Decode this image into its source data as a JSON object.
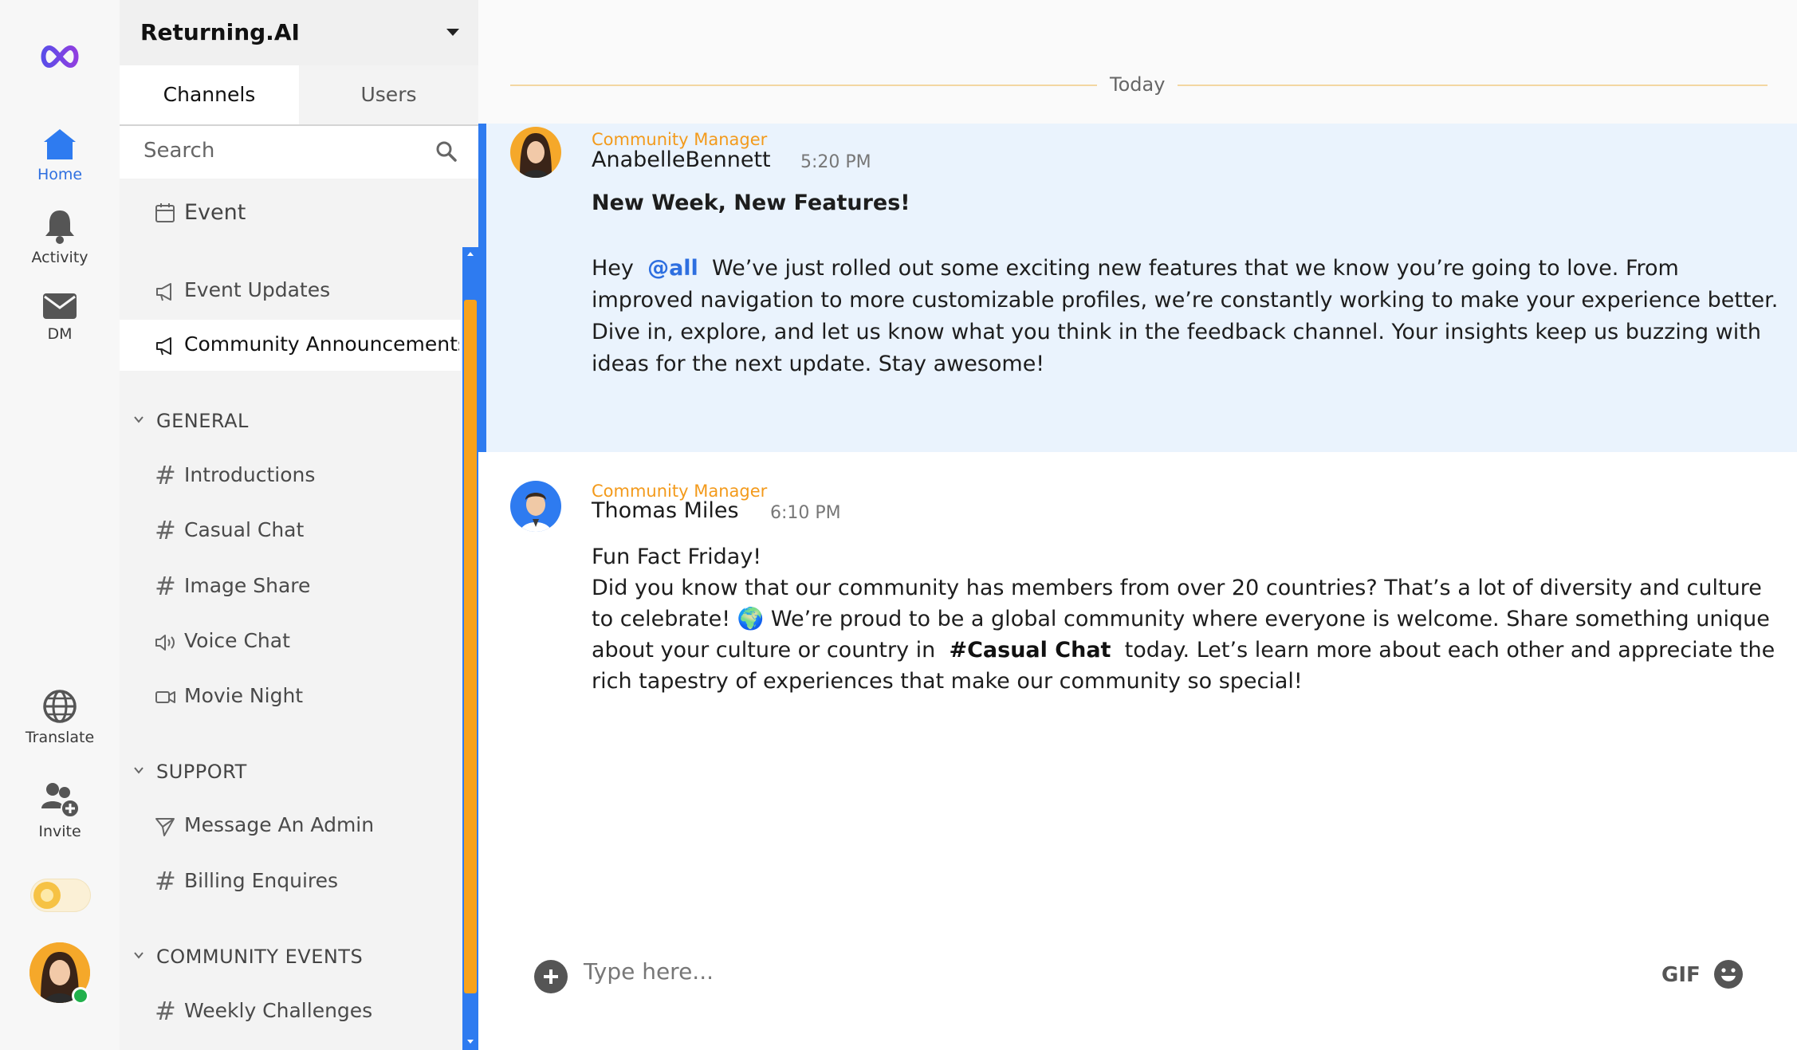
{
  "rail": {
    "logo": "infinity-logo",
    "items": [
      {
        "label": "Home",
        "icon": "home-icon"
      },
      {
        "label": "Activity",
        "icon": "bell-icon"
      },
      {
        "label": "DM",
        "icon": "mail-icon"
      },
      {
        "label": "Translate",
        "icon": "globe-icon"
      },
      {
        "label": "Invite",
        "icon": "add-users-icon"
      }
    ],
    "accent": "#2e6fe0"
  },
  "workspace": {
    "name": "Returning.AI"
  },
  "tabs": [
    {
      "label": "Channels"
    },
    {
      "label": "Users"
    }
  ],
  "search": {
    "placeholder": "Search"
  },
  "channels": {
    "event_header": "Event",
    "events": [
      {
        "name": "Event Updates",
        "icon": "megaphone-icon"
      },
      {
        "name": "Community Announcements",
        "icon": "megaphone-icon"
      }
    ],
    "groups": [
      {
        "name": "GENERAL",
        "items": [
          {
            "name": "Introductions",
            "icon": "hash-icon"
          },
          {
            "name": "Casual Chat",
            "icon": "hash-icon"
          },
          {
            "name": "Image Share",
            "icon": "hash-icon"
          },
          {
            "name": "Voice Chat",
            "icon": "speaker-icon"
          },
          {
            "name": "Movie Night",
            "icon": "video-icon"
          }
        ]
      },
      {
        "name": "SUPPORT",
        "items": [
          {
            "name": "Message An Admin",
            "icon": "send-icon"
          },
          {
            "name": "Billing Enquires",
            "icon": "hash-icon"
          }
        ]
      },
      {
        "name": "COMMUNITY EVENTS",
        "items": [
          {
            "name": "Weekly Challenges",
            "icon": "hash-icon"
          }
        ]
      }
    ]
  },
  "chat": {
    "date_divider": "Today",
    "messages": [
      {
        "role": "Community Manager",
        "author": "AnabelleBennett",
        "time": "5:20 PM",
        "title": "New Week, New Features!",
        "body_prefix": "Hey",
        "mention": "@all",
        "body": "We’ve just rolled out some exciting new features that we know you’re going to love. From improved navigation to more customizable profiles, we’re constantly working to make your experience better. Dive in, explore, and let us know what you think in the feedback channel. Your insights keep us buzzing with ideas for the next update. Stay awesome!"
      },
      {
        "role": "Community Manager",
        "author": "Thomas Miles",
        "time": "6:10 PM",
        "title": "Fun Fact Friday!",
        "body_part1": "Did you know that our community has members from over 20 countries? That’s a lot of diversity and culture to celebrate!",
        "emoji": "🌍",
        "body_part2": "We’re proud to be a global community where everyone is welcome. Share something unique about your culture or country in",
        "channel_ref": "#Casual Chat",
        "body_part3": "today. Let’s learn more about each other and appreciate the rich tapestry of experiences that make our community so special!"
      }
    ]
  },
  "composer": {
    "placeholder": "Type here...",
    "gif_label": "GIF"
  },
  "colors": {
    "accent_orange": "#f7a21b",
    "accent_blue": "#2e7bf0",
    "role_color": "#f39a1b",
    "online": "#22b14c"
  }
}
